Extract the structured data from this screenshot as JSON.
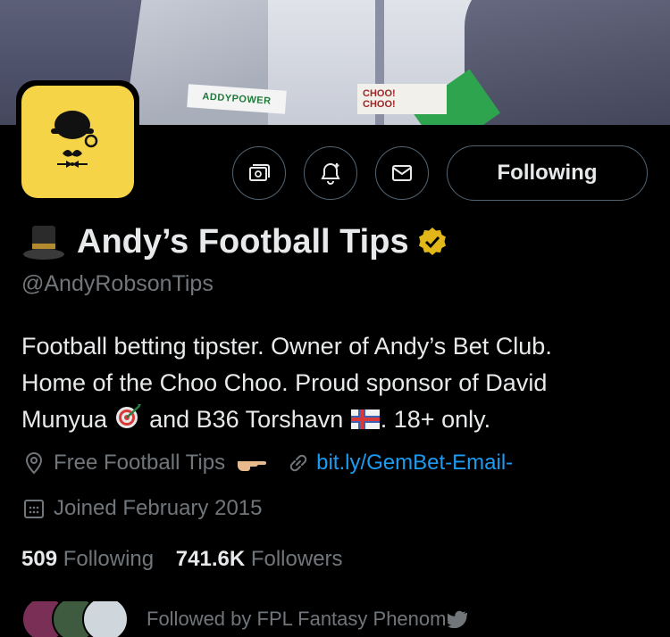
{
  "banner": {
    "sponsor_text": "ADDYPOWER",
    "choo_line1": "CHOO!",
    "choo_line2": "CHOO!"
  },
  "actions": {
    "following_label": "Following",
    "icons": [
      "subscribe-icon",
      "notification-bell-icon",
      "message-icon"
    ]
  },
  "profile": {
    "display_name": "Andy’s Football Tips",
    "handle": "@AndyRobsonTips",
    "bio": {
      "line1": "Football betting tipster. Owner of Andy’s Bet Club.",
      "line2": "Home of the Choo Choo. Proud sponsor of David",
      "line3_a": "Munyua",
      "line3_b": " and B36 Torshavn",
      "line3_c": ". 18+ only."
    },
    "location": "Free Football Tips",
    "link": "bit.ly/GemBet-Email-",
    "joined": "Joined February 2015"
  },
  "stats": {
    "following_count": "509",
    "following_label": "Following",
    "followers_count": "741.6K",
    "followers_label": "Followers"
  },
  "followed_by": {
    "text": "Followed by FPL Fantasy Phenom"
  },
  "colors": {
    "background": "#000000",
    "text": "#e7e9ea",
    "muted": "#71767b",
    "link": "#1d9bf0",
    "border": "#536471",
    "verified": "#e2b719",
    "avatar_bg": "#f5d547"
  }
}
